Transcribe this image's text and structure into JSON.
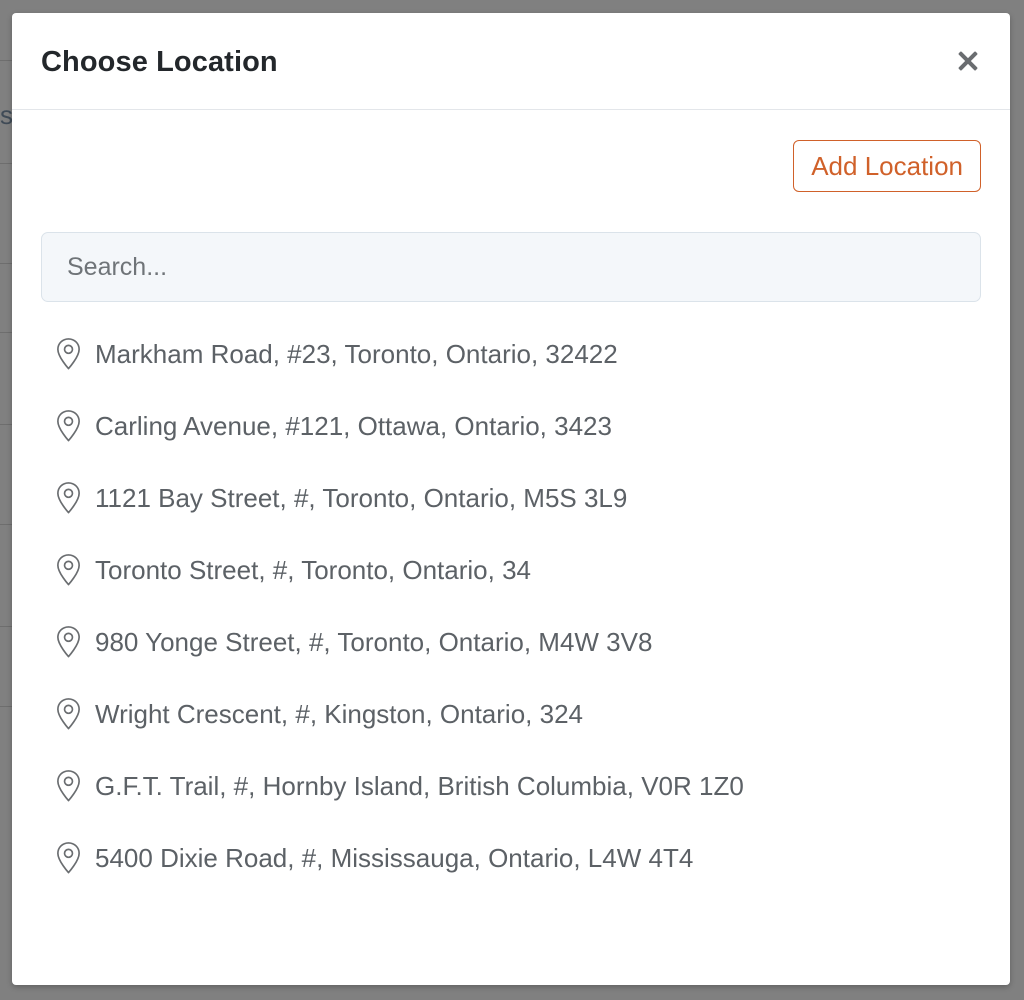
{
  "background": {
    "partial_text": "s"
  },
  "modal": {
    "title": "Choose Location",
    "close_icon": "close-icon",
    "add_button_label": "Add Location",
    "search": {
      "placeholder": "Search...",
      "value": ""
    },
    "pin_icon": "map-pin-icon",
    "locations": [
      "Markham Road, #23, Toronto, Ontario, 32422",
      "Carling Avenue, #121, Ottawa, Ontario, 3423",
      "1121 Bay Street, #, Toronto, Ontario, M5S 3L9",
      "Toronto Street, #, Toronto, Ontario, 34",
      "980 Yonge Street, #, Toronto, Ontario, M4W 3V8",
      "Wright Crescent, #, Kingston, Ontario, 324",
      "G.F.T. Trail, #, Hornby Island, British Columbia, V0R 1Z0",
      "5400 Dixie Road, #, Mississauga, Ontario, L4W 4T4"
    ]
  },
  "colors": {
    "accent": "#d0612a",
    "title_text": "#23272b",
    "list_text": "#5c6166",
    "overlay": "#808080"
  }
}
